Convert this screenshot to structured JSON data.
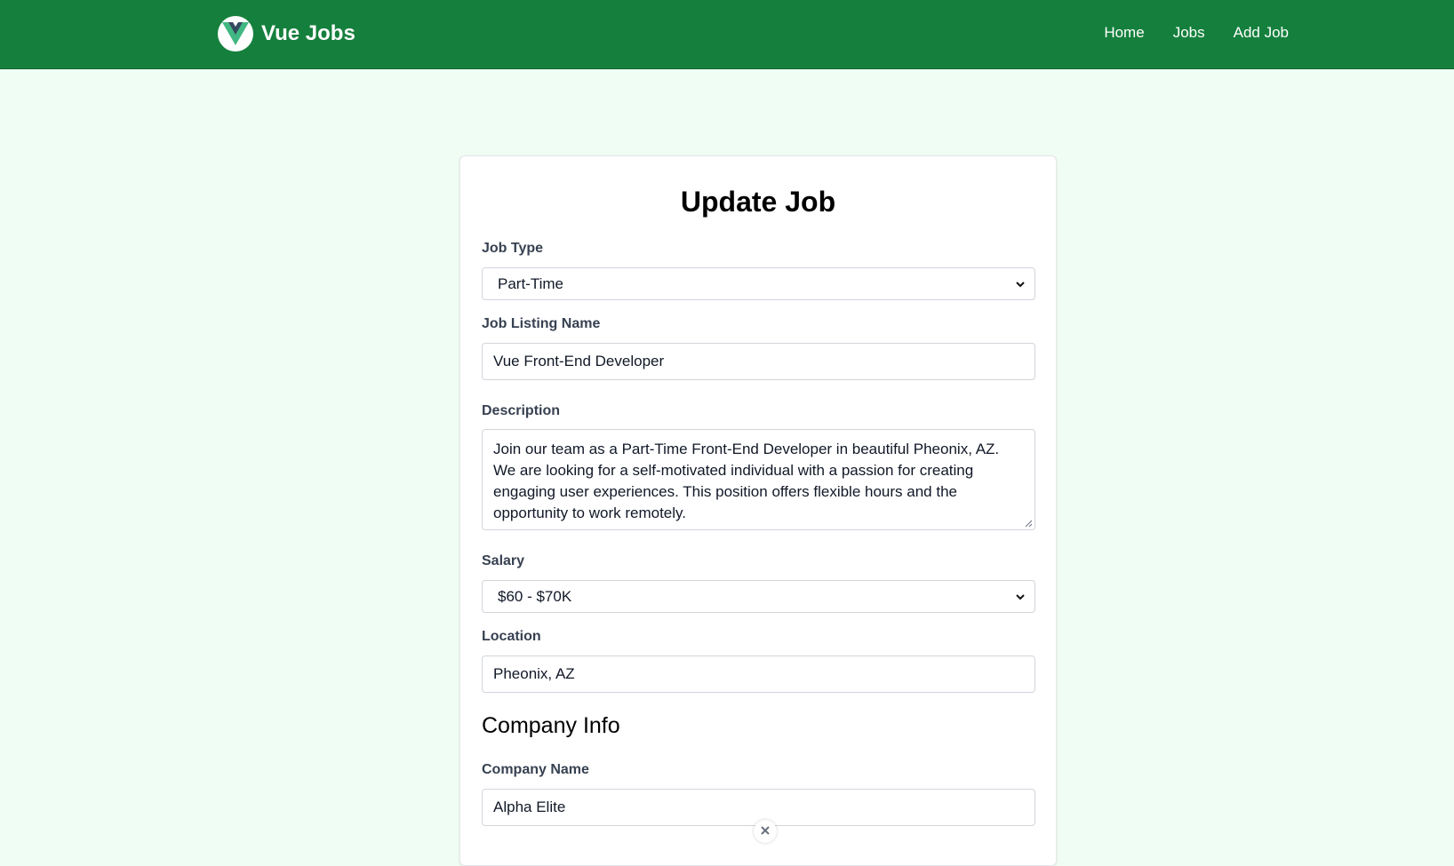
{
  "nav": {
    "brand": "Vue Jobs",
    "links": [
      "Home",
      "Jobs",
      "Add Job"
    ]
  },
  "form": {
    "title": "Update Job",
    "job_type": {
      "label": "Job Type",
      "value": "Part-Time"
    },
    "job_name": {
      "label": "Job Listing Name",
      "value": "Vue Front-End Developer"
    },
    "description": {
      "label": "Description",
      "value": "Join our team as a Part-Time Front-End Developer in beautiful Pheonix, AZ. We are looking for a self-motivated individual with a passion for creating engaging user experiences. This position offers flexible hours and the opportunity to work remotely."
    },
    "salary": {
      "label": "Salary",
      "value": "$60 - $70K"
    },
    "location": {
      "label": "Location",
      "value": "Pheonix, AZ"
    },
    "company_section": "Company Info",
    "company_name": {
      "label": "Company Name",
      "value": "Alpha Elite"
    }
  },
  "colors": {
    "navbar": "#15803d",
    "page_background": "#f0fdf4",
    "logo_green": "#41b883",
    "logo_dark": "#34495e"
  },
  "icons": [
    "vue-logo-icon",
    "chevron-down-icon",
    "resize-handle-icon",
    "close-icon"
  ]
}
